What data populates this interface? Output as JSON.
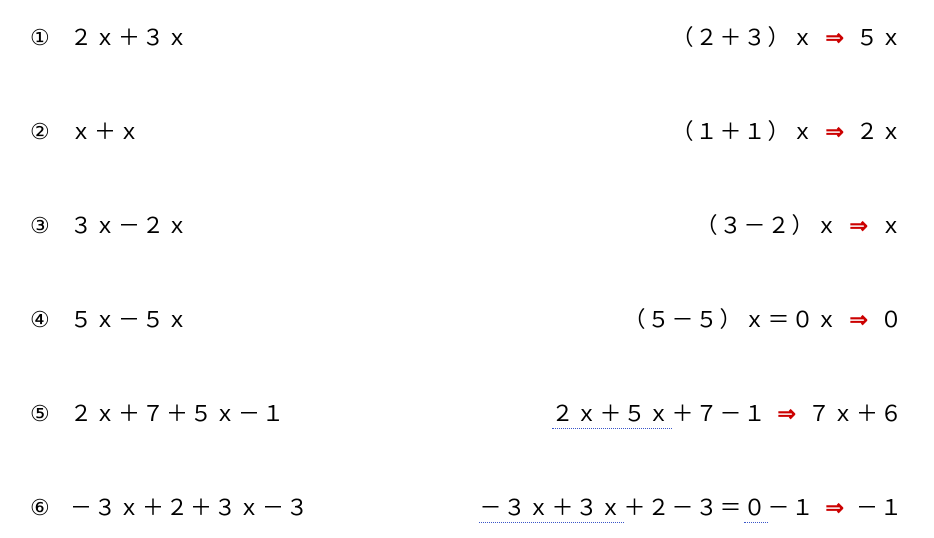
{
  "problems": [
    {
      "num": "①",
      "expr": "２ｘ＋３ｘ",
      "work": "（２＋３）ｘ",
      "arrow": "⇒",
      "ans": "５ｘ",
      "underline_parts": []
    },
    {
      "num": "②",
      "expr": "ｘ＋ｘ",
      "work": "（１＋１）ｘ",
      "arrow": "⇒",
      "ans": "２ｘ",
      "underline_parts": []
    },
    {
      "num": "③",
      "expr": "３ｘ－２ｘ",
      "work": "（３－２）ｘ",
      "arrow": "⇒",
      "ans": "ｘ",
      "underline_parts": []
    },
    {
      "num": "④",
      "expr": "５ｘ－５ｘ",
      "work": "（５－５）ｘ＝０ｘ",
      "arrow": "⇒",
      "ans": "０",
      "underline_parts": []
    },
    {
      "num": "⑤",
      "expr": "２ｘ＋７＋５ｘ－１",
      "work_parts": [
        {
          "text": "２ｘ＋５ｘ",
          "u": true
        },
        {
          "text": "＋７－１",
          "u": false
        }
      ],
      "arrow": "⇒",
      "ans": "７ｘ＋６"
    },
    {
      "num": "⑥",
      "expr": "－３ｘ＋２＋３ｘ－３",
      "work_parts": [
        {
          "text": "－３ｘ＋３ｘ",
          "u": true
        },
        {
          "text": "＋２－３＝",
          "u": false
        },
        {
          "text": "０",
          "u": true
        },
        {
          "text": "－１",
          "u": false
        }
      ],
      "arrow": "⇒",
      "ans": "－１"
    }
  ]
}
